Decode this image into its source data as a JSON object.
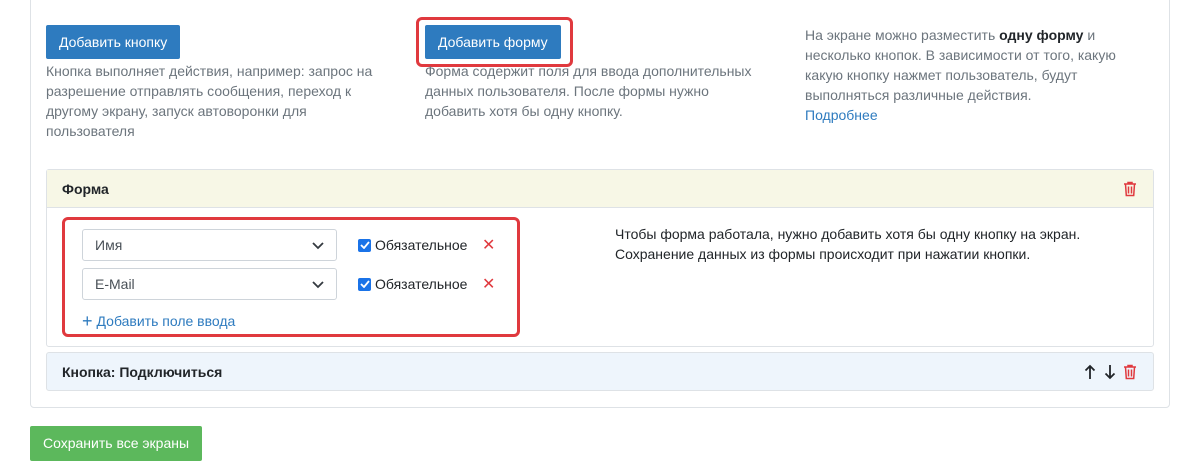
{
  "top": {
    "add_button": {
      "label": "Добавить кнопку",
      "description": "Кнопка выполняет действия, например: запрос на разрешение отправлять сообщения, переход к другому экрану, запуск автоворонки для пользователя"
    },
    "add_form": {
      "label": "Добавить форму",
      "description": "Форма содержит поля для ввода дополнительных данных пользователя. После формы нужно добавить хотя бы одну кнопку."
    },
    "info": {
      "text_before": "На экране можно разместить ",
      "text_bold": "одну форму",
      "text_after": " и несколько кнопок. В зависимости от того, какую какую кнопку нажмет пользователь, будут выполняться различные действия.",
      "more_link": "Подробнее"
    }
  },
  "form_panel": {
    "title": "Форма",
    "fields": [
      {
        "value": "Имя",
        "required_label": "Обязательное",
        "required": true
      },
      {
        "value": "E-Mail",
        "required_label": "Обязательное",
        "required": true
      }
    ],
    "add_field_label": "Добавить поле ввода",
    "note_line1": "Чтобы форма работала, нужно добавить хотя бы одну кнопку на экран.",
    "note_line2": "Сохранение данных из формы происходит при нажатии кнопки."
  },
  "button_panel": {
    "title": "Кнопка: Подключиться"
  },
  "footer": {
    "save_all_label": "Сохранить все экраны"
  },
  "colors": {
    "primary": "#2e7bbf",
    "success": "#5cb85c",
    "danger": "#e0393e",
    "form_header_bg": "#f7f7e6",
    "button_header_bg": "#eef5fc"
  }
}
